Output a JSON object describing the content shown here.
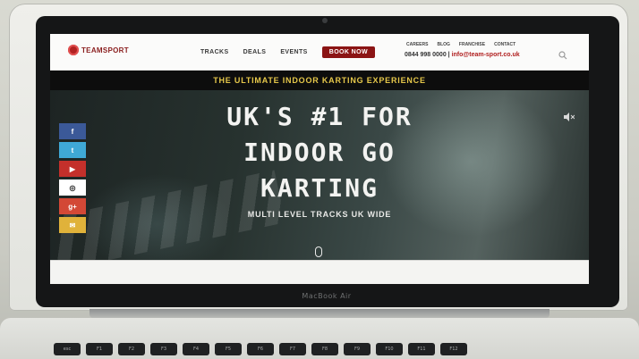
{
  "device": {
    "brand_label": "MacBook Air"
  },
  "site": {
    "logo_text": "TEAMSPORT",
    "nav": [
      {
        "label": "TRACKS"
      },
      {
        "label": "DEALS"
      },
      {
        "label": "EVENTS"
      }
    ],
    "book_label": "BOOK NOW",
    "util_links": [
      "CAREERS",
      "BLOG",
      "FRANCHISE",
      "CONTACT"
    ],
    "phone": "0844 998 0000",
    "email": "info@team-sport.co.uk",
    "strapline": "THE ULTIMATE INDOOR KARTING EXPERIENCE",
    "hero": {
      "title_line1": "UK'S #1 FOR",
      "title_line2": "INDOOR GO",
      "title_line3": "KARTING",
      "subtitle": "MULTI LEVEL TRACKS UK WIDE"
    },
    "social": [
      {
        "name": "facebook",
        "glyph": "f",
        "color": "#3b5998"
      },
      {
        "name": "twitter",
        "glyph": "t",
        "color": "#3fa9d6"
      },
      {
        "name": "youtube",
        "glyph": "▶",
        "color": "#c4302b"
      },
      {
        "name": "instagram",
        "glyph": "◎",
        "color": "#ffffff"
      },
      {
        "name": "google-plus",
        "glyph": "g+",
        "color": "#d34836"
      },
      {
        "name": "email",
        "glyph": "✉",
        "color": "#e0b23a"
      }
    ]
  },
  "keyboard": {
    "keys": [
      "esc",
      "F1",
      "F2",
      "F3",
      "F4",
      "F5",
      "F6",
      "F7",
      "F8",
      "F9",
      "F10",
      "F11",
      "F12"
    ]
  }
}
